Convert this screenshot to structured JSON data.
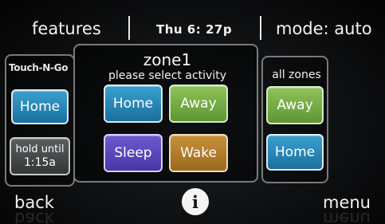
{
  "topbar": {
    "features_label": "features",
    "time": "Thu  6: 27p",
    "mode_label": "mode: auto"
  },
  "left_panel": {
    "brand": "Touch-N-Go",
    "home_label": "Home",
    "hold_line1": "hold until",
    "hold_line2": "1:15a"
  },
  "center_panel": {
    "zone_title": "zone1",
    "subtitle": "please select activity",
    "home_label": "Home",
    "away_label": "Away",
    "sleep_label": "Sleep",
    "wake_label": "Wake"
  },
  "right_panel": {
    "title": "all zones",
    "away_label": "Away",
    "home_label": "Home"
  },
  "bottombar": {
    "back_label": "back",
    "menu_label": "menu",
    "info_icon": "i"
  },
  "colors": {
    "home_button": "#2a88b8",
    "away_button": "#77ad47",
    "sleep_button": "#5b48bb",
    "wake_button": "#b27d2b",
    "hold_button": "#474b4c"
  }
}
